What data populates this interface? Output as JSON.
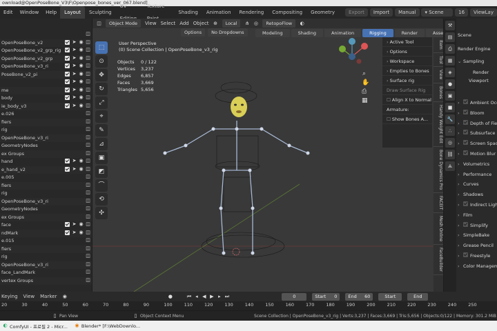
{
  "titlebar": {
    "text": "ownload@OpenPoseBone_V3\\F\\Openpose_bones_ver_067.blend]"
  },
  "menubar": {
    "menus": [
      "Edit",
      "Window",
      "Help"
    ],
    "workspaces": [
      "Layout",
      "Sculpting",
      "UV Editing",
      "Texture Paint",
      "Shading",
      "Animation",
      "Rendering",
      "Compositing",
      "Geometry"
    ],
    "active_workspace": "Layout",
    "export_label": "Export",
    "import_label": "Import",
    "manual_label": "Manual",
    "scene_label": "Scene",
    "frame_num": "16",
    "view_layer_label": "ViewLay"
  },
  "outliner": {
    "rows": [
      {
        "text": "",
        "top": 0
      },
      {
        "text": "OpenPoseBone_v2",
        "checks": true
      },
      {
        "text": "OpenPoseBone_v2_grp_rig",
        "checks": true
      },
      {
        "text": "OpenPoseBone_v2_grp",
        "checks": true
      },
      {
        "text": "OpenPoseBone_v3_ri",
        "checks": true
      },
      {
        "text": "PoseBone_v2_pi",
        "checks": true
      },
      {
        "text": "",
        "checks": true
      },
      {
        "text": "me",
        "checks": true
      },
      {
        "text": "body",
        "checks": true
      },
      {
        "text": "ie_body_v3",
        "checks": true
      },
      {
        "text": "e.026",
        "checks": false
      },
      {
        "text": "fiers",
        "checks": false
      },
      {
        "text": "rig",
        "checks": false
      },
      {
        "text": "OpenPoseBone_v3_ri",
        "checks": false
      },
      {
        "text": "GeometryNodes",
        "checks": false
      },
      {
        "text": "ex Groups",
        "checks": false
      },
      {
        "text": "hand",
        "checks": true
      },
      {
        "text": "e_hand_v2",
        "checks": true
      },
      {
        "text": "e.005",
        "checks": false
      },
      {
        "text": "fiers",
        "checks": false
      },
      {
        "text": "rig",
        "checks": false
      },
      {
        "text": "OpenPoseBone_v3_ri",
        "checks": false
      },
      {
        "text": "GeometryNodes",
        "checks": false
      },
      {
        "text": "ex Groups",
        "checks": false
      },
      {
        "text": "face",
        "checks": true
      },
      {
        "text": "ndMark",
        "checks": true
      },
      {
        "text": "e.015",
        "checks": false
      },
      {
        "text": "fiers",
        "checks": false
      },
      {
        "text": "rig",
        "checks": false
      },
      {
        "text": "OpenPoseBone_v3_ri",
        "checks": false
      },
      {
        "text": "face_LandMark",
        "checks": false
      },
      {
        "text": "vertex Groups",
        "checks": false
      }
    ]
  },
  "viewport": {
    "object_mode": "Object Mode",
    "menu": [
      "View",
      "Select",
      "Add",
      "Object"
    ],
    "orientation": "Local",
    "snap_label": "RetopoFlow",
    "options_label": "Options",
    "dropdown_label": "No Dropdowns",
    "modes": [
      "Modeling",
      "Shading",
      "Animation",
      "Rigging",
      "Render",
      "Asset"
    ],
    "active_mode": "Rigging",
    "perspective": "User Perspective",
    "collection": "(0) Scene Collection | OpenPoseBone_v3_rig",
    "stats": [
      {
        "label": "Objects",
        "value": "0 / 122"
      },
      {
        "label": "Vertices",
        "value": "3,237"
      },
      {
        "label": "Edges",
        "value": "6,857"
      },
      {
        "label": "Faces",
        "value": "3,669"
      },
      {
        "label": "Triangles",
        "value": "5,656"
      }
    ],
    "side_panel": [
      "Active Tool",
      "Options",
      "Workspace",
      "Empties to Bones",
      "Surface rig",
      "Draw Surface Rig",
      "Align X to Normal",
      "Armature:",
      "Show Bones A..."
    ],
    "ntabs": [
      "Item",
      "Tool",
      "View",
      "Bones",
      "Handy Weight Edit",
      "Bone Dynamics Pro",
      "FACEIT",
      "Mesh Online",
      "FaceBuilder"
    ]
  },
  "properties": {
    "scene_label": "Scene",
    "render_engine_label": "Render Engine",
    "sampling_label": "Sampling",
    "render_label": "Render",
    "viewport_label": "Viewport",
    "sections": [
      "Ambient Occ",
      "Bloom",
      "Depth of Field",
      "Subsurface Scat",
      "Screen Space",
      "Motion Blur",
      "Volumetrics",
      "Performance",
      "Curves",
      "Shadows",
      "Indirect Lighting",
      "Film",
      "Simplify",
      "SimpleBake",
      "Grease Pencil",
      "Freestyle",
      "Color Managem"
    ]
  },
  "timeline": {
    "menus": [
      "Keying",
      "View",
      "Marker"
    ],
    "current_frame": "0",
    "start_label": "Start",
    "start_value": "0",
    "end_label": "End",
    "end_value": "60",
    "start2_label": "Start",
    "end2_label": "End",
    "ticks": [
      "20",
      "30",
      "40",
      "50",
      "60",
      "70",
      "80",
      "90",
      "100",
      "110",
      "120",
      "130",
      "140",
      "150",
      "160",
      "170",
      "180",
      "190",
      "200",
      "210",
      "220",
      "230",
      "240",
      "250"
    ]
  },
  "statusbar": {
    "pan_view": "Pan View",
    "context_menu": "Object Context Menu",
    "stats": "Scene Collection | OpenPoseBone_v3_rig | Verts:3,237 | Faces:3,669 | Tris:5,656 | Objects:0/122 | Memory: 301.2 MiB | VRAM"
  },
  "taskbar": {
    "items": [
      "ComfyUI - 프로필 2 - Micr...",
      "Blender* [F:\\WebDownlo..."
    ]
  },
  "colors": {
    "accent": "#4772b3",
    "bg_viewport": "#393939",
    "panel": "#282828"
  }
}
